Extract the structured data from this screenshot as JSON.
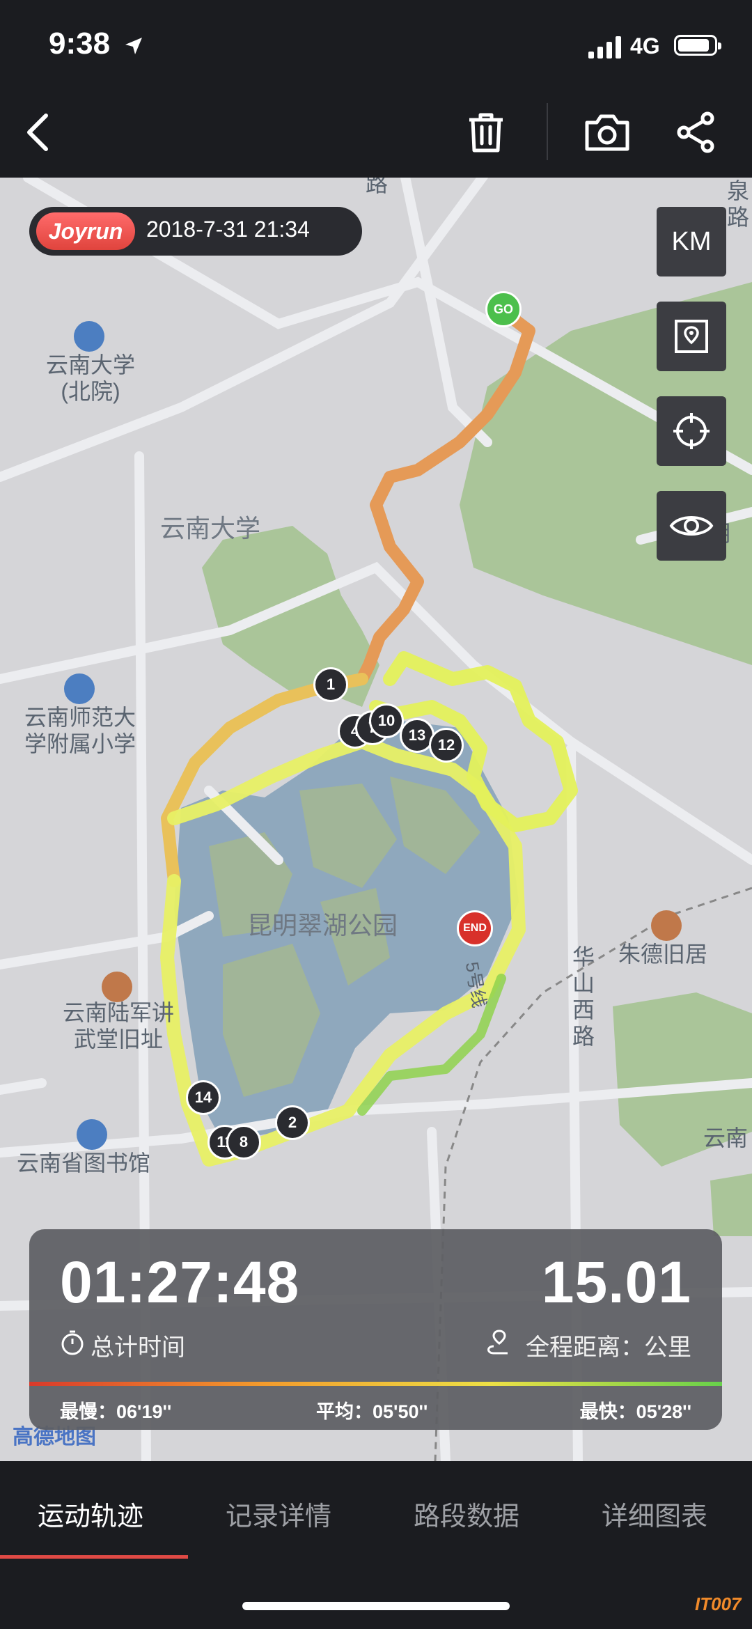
{
  "status_bar": {
    "time": "9:38",
    "network": "4G"
  },
  "map": {
    "app_logo": "Joyrun",
    "datetime": "2018-7-31 21:34",
    "unit_button": "KM",
    "start_marker": "GO",
    "end_marker": "END",
    "km_markers": [
      "1",
      "2",
      "4",
      "7",
      "10",
      "13",
      "12",
      "14",
      "11",
      "8"
    ],
    "labels": {
      "yunnan_univ_north": "云南大学\n(北院)",
      "yunnan_univ": "云南大学",
      "normal_school": "云南师范大\n学附属小学",
      "cuihu_park": "昆明翠湖公园",
      "military_academy": "云南陆军讲\n武堂旧址",
      "library": "云南省图书馆",
      "zhude_house": "朱德旧居",
      "huashan_road": "华\n山\n西\n路",
      "line5": "5号线",
      "kunming_edge": "昆明",
      "yunnan_edge": "云南",
      "road_top_right": "泉\n路",
      "road_top": "路",
      "amap": "高德地图"
    },
    "icons": [
      "location-pin-icon",
      "locate-target-icon",
      "eye-icon"
    ]
  },
  "stats": {
    "total_time": "01:27:48",
    "total_time_label": "总计时间",
    "distance": "15.01",
    "distance_label": "全程距离：公里",
    "slowest_label": "最慢：06'19''",
    "average_label": "平均：05'50''",
    "fastest_label": "最快：05'28''"
  },
  "tabs": [
    "运动轨迹",
    "记录详情",
    "路段数据",
    "详细图表"
  ],
  "watermark": "IT007",
  "colors": {
    "accent": "#e04a45",
    "route_start": "#e59a57",
    "route_fast": "#e9f55a",
    "go": "#4cbf4c",
    "end": "#d8312b"
  }
}
